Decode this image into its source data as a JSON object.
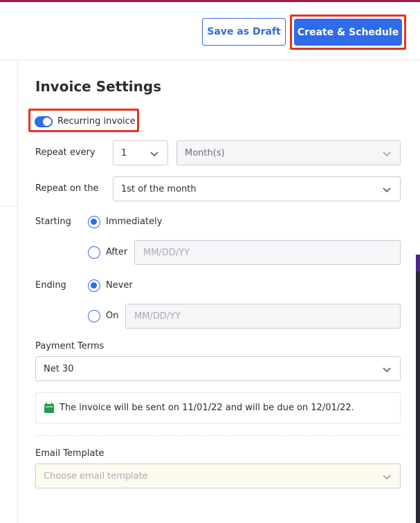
{
  "header": {
    "save_draft_label": "Save as Draft",
    "create_schedule_label": "Create & Schedule"
  },
  "settings": {
    "title": "Invoice Settings",
    "recurring_label": "Recurring invoice",
    "recurring_enabled": true,
    "repeat_every_label": "Repeat every",
    "repeat_every_value": "1",
    "repeat_unit_value": "Month(s)",
    "repeat_on_label": "Repeat on the",
    "repeat_on_value": "1st of the month",
    "starting_label": "Starting",
    "starting_options": [
      {
        "label": "Immediately",
        "checked": true
      },
      {
        "label": "After",
        "checked": false,
        "placeholder": "MM/DD/YY"
      }
    ],
    "ending_label": "Ending",
    "ending_options": [
      {
        "label": "Never",
        "checked": true
      },
      {
        "label": "On",
        "checked": false,
        "placeholder": "MM/DD/YY"
      }
    ],
    "payment_terms_label": "Payment Terms",
    "payment_terms_value": "Net 30",
    "notice_text": "The invoice will be sent on 11/01/22 and will be due on 12/01/22.",
    "email_template_label": "Email Template",
    "email_template_placeholder": "Choose email template"
  },
  "colors": {
    "accent": "#2f6bea",
    "highlight": "#e3341d",
    "calendar_icon": "#1f9d4c"
  }
}
